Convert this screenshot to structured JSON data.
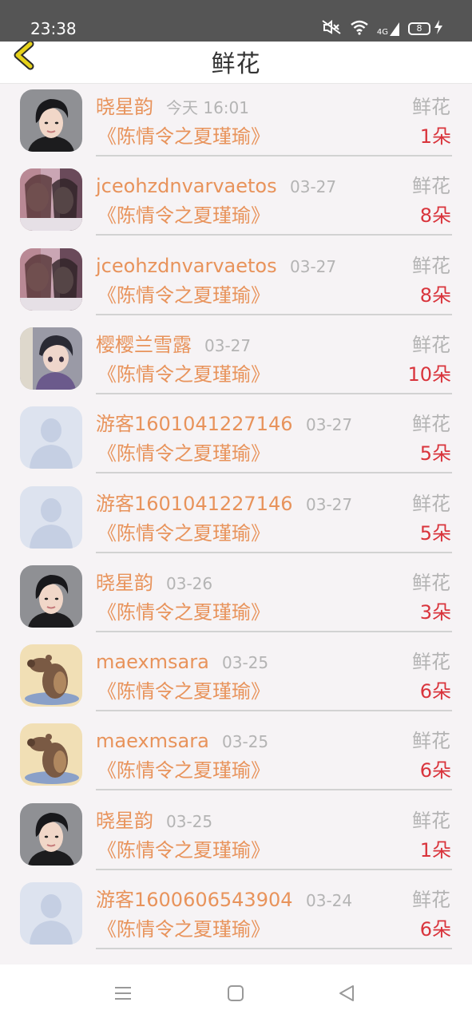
{
  "status_bar": {
    "time": "23:38",
    "network": "4G",
    "battery": "8",
    "icons": [
      "mute-icon",
      "wifi-icon",
      "signal-icon",
      "battery-icon",
      "charging-icon"
    ]
  },
  "header": {
    "title": "鲜花",
    "back_icon": "chevron-left-icon",
    "back_color": "#e6d21a"
  },
  "colors": {
    "name": "#e8935b",
    "meta": "#b4b4b4",
    "count": "#d9343c",
    "divider": "#d2d2d2"
  },
  "records": [
    {
      "user": "晓星韵",
      "time": "今天 16:01",
      "type": "鲜花",
      "book": "《陈情令之夏瑾瑜》",
      "count": "1朵",
      "avatar": "portrait-short-hair"
    },
    {
      "user": "jceohzdnvarvaetos",
      "time": "03-27",
      "type": "鲜花",
      "book": "《陈情令之夏瑾瑜》",
      "count": "8朵",
      "avatar": "photo-girls"
    },
    {
      "user": "jceohzdnvarvaetos",
      "time": "03-27",
      "type": "鲜花",
      "book": "《陈情令之夏瑾瑜》",
      "count": "8朵",
      "avatar": "photo-girls"
    },
    {
      "user": "樱樱兰雪露",
      "time": "03-27",
      "type": "鲜花",
      "book": "《陈情令之夏瑾瑜》",
      "count": "10朵",
      "avatar": "anime-character"
    },
    {
      "user": "游客1601041227146",
      "time": "03-27",
      "type": "鲜花",
      "book": "《陈情令之夏瑾瑜》",
      "count": "5朵",
      "avatar": "default-user"
    },
    {
      "user": "游客1601041227146",
      "time": "03-27",
      "type": "鲜花",
      "book": "《陈情令之夏瑾瑜》",
      "count": "5朵",
      "avatar": "default-user"
    },
    {
      "user": "晓星韵",
      "time": "03-26",
      "type": "鲜花",
      "book": "《陈情令之夏瑾瑜》",
      "count": "3朵",
      "avatar": "portrait-short-hair"
    },
    {
      "user": "maexmsara",
      "time": "03-25",
      "type": "鲜花",
      "book": "《陈情令之夏瑾瑜》",
      "count": "6朵",
      "avatar": "bear-cartoon"
    },
    {
      "user": "maexmsara",
      "time": "03-25",
      "type": "鲜花",
      "book": "《陈情令之夏瑾瑜》",
      "count": "6朵",
      "avatar": "bear-cartoon"
    },
    {
      "user": "晓星韵",
      "time": "03-25",
      "type": "鲜花",
      "book": "《陈情令之夏瑾瑜》",
      "count": "1朵",
      "avatar": "portrait-short-hair"
    },
    {
      "user": "游客1600606543904",
      "time": "03-24",
      "type": "鲜花",
      "book": "《陈情令之夏瑾瑜》",
      "count": "6朵",
      "avatar": "default-user"
    }
  ],
  "nav_bar": {
    "icons": [
      "menu-icon",
      "home-square-icon",
      "back-triangle-icon"
    ]
  }
}
